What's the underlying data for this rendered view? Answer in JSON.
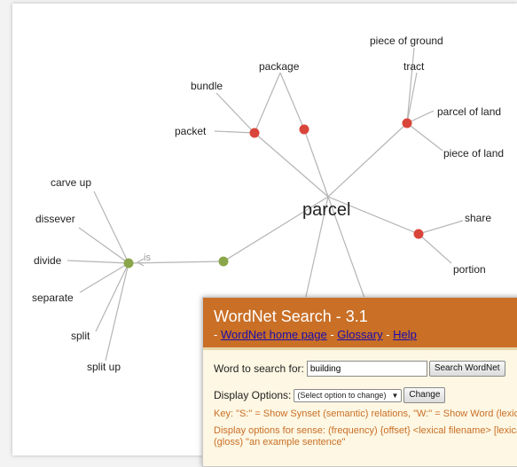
{
  "graph": {
    "center_word": "parcel",
    "edge_label": "is",
    "labels": {
      "piece_of_ground": "piece of ground",
      "tract": "tract",
      "package": "package",
      "bundle": "bundle",
      "packet": "packet",
      "parcel_of_land": "parcel of land",
      "piece_of_land": "piece of land",
      "carve_up": "carve up",
      "dissever": "dissever",
      "divide": "divide",
      "separate": "separate",
      "split": "split",
      "split_up": "split up",
      "share": "share",
      "portion": "portion"
    },
    "colors": {
      "noun_node": "#d9453a",
      "verb_node": "#8aa64a",
      "edge": "#b5b5b5"
    }
  },
  "wordnet": {
    "title": "WordNet Search - 3.1",
    "home_link": "WordNet home page",
    "glossary_link": "Glossary",
    "help_link": "Help",
    "link_separator": "-",
    "search_label": "Word to search for:",
    "search_value": "building",
    "search_button": "Search WordNet",
    "options_label": "Display Options:",
    "options_selected": "(Select option to change)",
    "change_button": "Change",
    "key_text": "Key: \"S:\" = Show Synset (semantic) relations, \"W:\" = Show Word (lexical) relations",
    "display_text": "Display options for sense: (frequency) {offset} <lexical filename> [lexical file number]",
    "gloss_text": "(gloss) \"an example sentence\"",
    "header_color": "#c96f26",
    "body_color": "#fdf7e3"
  }
}
